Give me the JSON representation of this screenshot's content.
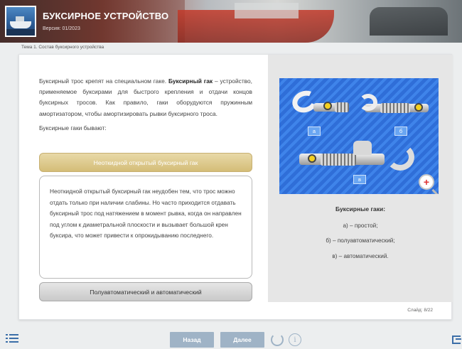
{
  "header": {
    "title": "БУКСИРНОЕ УСТРОЙСТВО",
    "version": "Версия: 01/2023"
  },
  "breadcrumb": "Тема 1. Состав буксирного устройства",
  "content": {
    "intro_start": "Буксирный трос крепят на специальном гаке. ",
    "intro_bold": "Буксирный гак",
    "intro_rest": " – устройство, применяемое буксирами для быстрого крепления и отдачи концов буксирных тросов. Как правило, гаки оборудуются пружинным амортизатором, чтобы амортизировать рывки буксирного троса.",
    "types_label": "Буксирные гаки бывают:",
    "accordion": [
      {
        "label": "Неоткидной открытый буксирный гак",
        "body": "Неоткидной открытый буксирный гак неудобен тем, что трос можно отдать только при наличии слабины. Но часто приходится отдавать буксирный трос под натяжением в момент рывка, когда он направлен под углом к диаметральной плоскости и вызывает большой крен буксира, что может привести к опрокидыванию последнего."
      },
      {
        "label": "Полуавтоматический и автоматический"
      }
    ]
  },
  "figure": {
    "labels": [
      "а",
      "б",
      "в"
    ],
    "caption_title": "Буксирные гаки:",
    "caption_lines": [
      "а) – простой;",
      "б) – полуавтоматический;",
      "в) – автоматический."
    ]
  },
  "slide_counter": "Слайд: 8/22",
  "footer": {
    "back_label": "Назад",
    "next_label": "Далее",
    "info_glyph": "i"
  },
  "colors": {
    "accent_blue": "#3b6ea8",
    "button_gray_blue": "#9fb3c6",
    "accordion_active": "#d4bd77",
    "figure_blue": "#2f6ed8"
  },
  "icons": [
    "menu-icon",
    "reload-icon",
    "info-icon",
    "exit-icon",
    "zoom-icon"
  ]
}
